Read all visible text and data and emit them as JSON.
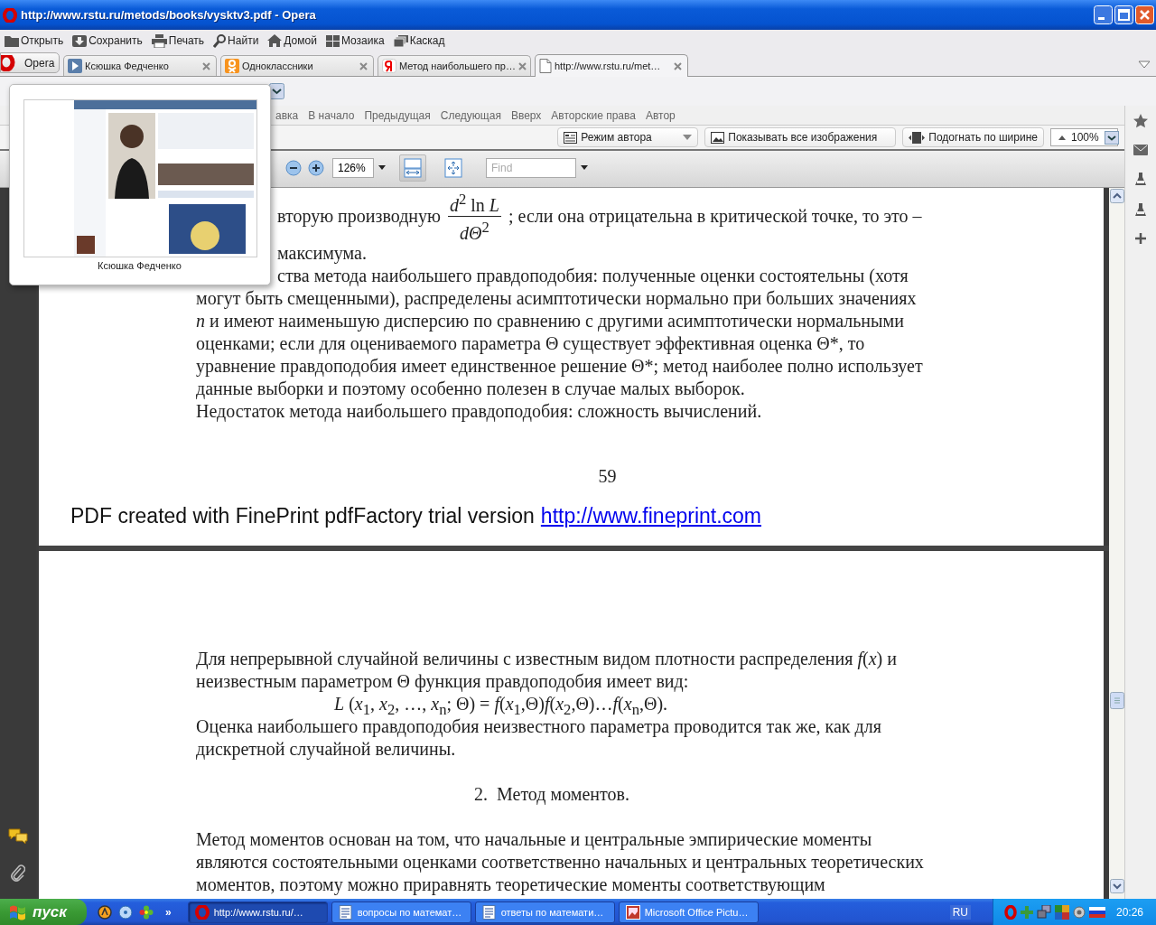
{
  "window": {
    "title": "http://www.rstu.ru/metods/books/vysktv3.pdf - Opera"
  },
  "toolbar": [
    {
      "label": "Открыть"
    },
    {
      "label": "Сохранить"
    },
    {
      "label": "Печать"
    },
    {
      "label": "Найти"
    },
    {
      "label": "Домой"
    },
    {
      "label": "Мозаика"
    },
    {
      "label": "Каскад"
    }
  ],
  "tabs": {
    "menu_button": "Opera",
    "items": [
      {
        "label": "Ксюшка Федченко",
        "selected": false
      },
      {
        "label": "Одноклассники",
        "selected": false
      },
      {
        "label": "Метод наибольшего пр…",
        "selected": false
      },
      {
        "label": "http://www.rstu.ru/met…",
        "selected": true
      }
    ]
  },
  "tab_preview": {
    "caption": "Ксюшка Федченко"
  },
  "page_nav": [
    "авка",
    "В начало",
    "Предыдущая",
    "Следующая",
    "Вверх",
    "Авторские права",
    "Автор"
  ],
  "view_options": {
    "author_mode": "Режим автора",
    "show_images": "Показывать все изображения",
    "fit_width": "Подогнать по ширине",
    "zoom": "100%"
  },
  "pdf_toolbar": {
    "zoom": "126%",
    "fit_buttons": [
      {
        "kind": "width",
        "selected": true
      },
      {
        "kind": "page",
        "selected": false
      }
    ],
    "find_placeholder": "Find"
  },
  "document": {
    "pages": [
      {
        "blocks": [
          {
            "kind": "fraction",
            "before": "вторую производную",
            "numerator": "*d*$^{2}$ ln *L*",
            "denominator": "*dΘ*$^{2}$",
            "after": "; если она отрицательна в критической точке, то это –"
          },
          {
            "kind": "cut_line",
            "text": "максимума."
          },
          {
            "kind": "cut_line",
            "text": "ства метода наибольшего правдоподобия: полученные оценки состоятельны (хотя"
          },
          {
            "kind": "line",
            "text": "могут быть смещенными), распределены асимптотически нормально при больших значениях"
          },
          {
            "kind": "line",
            "text": "*n* и имеют наименьшую дисперсию по сравнению с другими асимптотически нормальными"
          },
          {
            "kind": "line",
            "text": "оценками; если для оцениваемого параметра Θ существует эффективная оценка Θ*, то"
          },
          {
            "kind": "line",
            "text": "уравнение правдоподобия имеет единственное решение Θ*; метод наиболее полно использует"
          },
          {
            "kind": "line",
            "text": "данные выборки и поэтому особенно полезен в случае малых выборок."
          },
          {
            "kind": "line",
            "text": "Недостаток метода наибольшего правдоподобия: сложность вычислений."
          },
          {
            "kind": "page_number",
            "text": "59"
          },
          {
            "kind": "footer",
            "text": "PDF created with FinePrint pdfFactory trial version",
            "link": "http://www.fineprint.com"
          }
        ]
      },
      {
        "blocks": [
          {
            "kind": "line",
            "text": "Для непрерывной случайной величины с известным видом плотности распределения *f*(*x*) и"
          },
          {
            "kind": "line",
            "text": "неизвестным параметром Θ функция правдоподобия имеет вид:"
          },
          {
            "kind": "formula",
            "text": "*L* (*x*$_{1}$, *x*$_{2}$, …, *x*$_{n}$; Θ) = *f*(*x*$_{1}$,Θ)*f*(*x*$_{2}$,Θ)…*f*(*x*$_{n}$,Θ)."
          },
          {
            "kind": "line",
            "text": "Оценка наибольшего правдоподобия неизвестного параметра проводится так же, как для"
          },
          {
            "kind": "line",
            "text": "дискретной случайной величины."
          },
          {
            "kind": "heading",
            "text": "2.  Метод моментов."
          },
          {
            "kind": "line",
            "text": "Метод моментов основан на том, что начальные и центральные эмпирические моменты"
          },
          {
            "kind": "line",
            "text": "являются состоятельными оценками соответственно начальных и центральных теоретических"
          },
          {
            "kind": "line",
            "text": "моментов, поэтому можно приравнять теоретические моменты соответствующим"
          }
        ]
      }
    ]
  },
  "taskbar": {
    "start": "пуск",
    "more": "»",
    "tasks": [
      {
        "label": "http://www.rstu.ru/…",
        "selected": true
      },
      {
        "label": "вопросы по математ…",
        "selected": false
      },
      {
        "label": "ответы по математи…",
        "selected": false
      },
      {
        "label": "Microsoft Office Pictu…",
        "selected": false
      }
    ],
    "language": "RU",
    "clock": "20:26"
  }
}
